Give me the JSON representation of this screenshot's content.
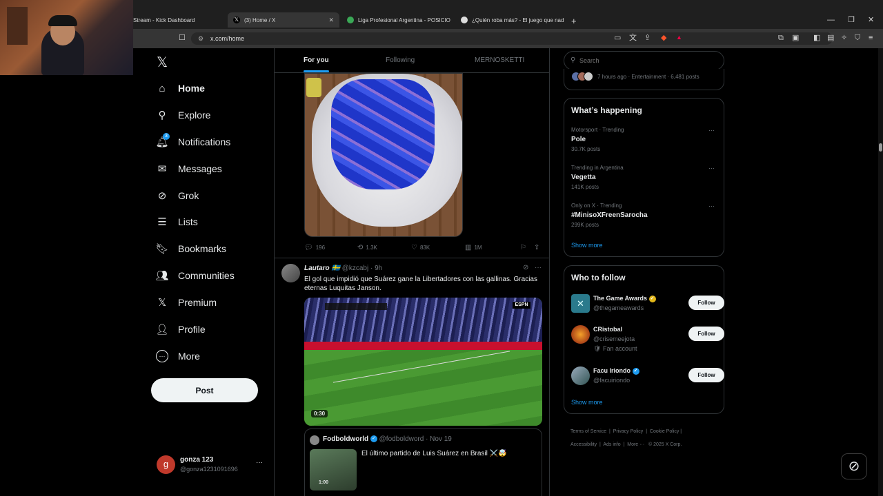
{
  "browser": {
    "tabs": [
      {
        "title": "Stream - Kick Dashboard"
      },
      {
        "title": "(3) Home / X"
      },
      {
        "title": "Liga Profesional Argentina - POSICIO"
      },
      {
        "title": "¿Quién roba más? - El juego que nad"
      }
    ],
    "address": "x.com/home",
    "new_tab": "+"
  },
  "colors": {
    "accent": "#1d9bf0",
    "bg": "#000000",
    "text": "#e7e9ea",
    "muted": "#71767b"
  },
  "nav": {
    "logo": "𝕏",
    "items": [
      {
        "label": "Home",
        "icon": "home-icon",
        "glyph": "⌂"
      },
      {
        "label": "Explore",
        "icon": "search-icon",
        "glyph": "⚲"
      },
      {
        "label": "Notifications",
        "icon": "bell-icon",
        "glyph": "🔔︎",
        "badge": "3"
      },
      {
        "label": "Messages",
        "icon": "mail-icon",
        "glyph": "✉"
      },
      {
        "label": "Grok",
        "icon": "grok-icon",
        "glyph": "⊘"
      },
      {
        "label": "Lists",
        "icon": "list-icon",
        "glyph": "☰"
      },
      {
        "label": "Bookmarks",
        "icon": "bookmark-icon",
        "glyph": "🔖︎"
      },
      {
        "label": "Communities",
        "icon": "people-icon",
        "glyph": "👥︎"
      },
      {
        "label": "Premium",
        "icon": "x-icon",
        "glyph": "𝕏"
      },
      {
        "label": "Profile",
        "icon": "person-icon",
        "glyph": "👤︎"
      },
      {
        "label": "More",
        "icon": "more-circle-icon",
        "glyph": "⋯"
      }
    ],
    "post_label": "Post",
    "account": {
      "name": "gonza 123",
      "handle": "@gonza1231091696",
      "avatar_letter": "g",
      "more": "···"
    }
  },
  "timeline": {
    "tabs": [
      "For you",
      "Following",
      "MERNOSKETTI"
    ],
    "post1": {
      "replies": "196",
      "reposts": "1.3K",
      "likes": "83K",
      "views": "1M"
    },
    "post2": {
      "author": "Lautaro 🇸🇪",
      "handle": "@kzcabj",
      "time": "· 9h",
      "text": "El gol que impidió que Suárez gane la Libertadores con las gallinas. Gracias eternas Luquitas Janson.",
      "video_duration": "0:30",
      "video_overlay": "ESPN",
      "quote": {
        "author": "Fodboldworld",
        "handle": "@fodboldword",
        "time": "· Nov 19",
        "text": "El último partido de Luis Suárez en Brasil ⚔️🤯",
        "duration": "1:00"
      }
    }
  },
  "right": {
    "search_placeholder": "Search",
    "trend_top": "7 hours ago · Entertainment · 6,481 posts",
    "whats_happening": {
      "title": "What’s happening",
      "items": [
        {
          "meta": "Motorsport · Trending",
          "name": "Pole",
          "posts": "30.7K posts"
        },
        {
          "meta": "Trending in Argentina",
          "name": "Vegetta",
          "posts": "141K posts"
        },
        {
          "meta": "Only on X · Trending",
          "name": "#MinisoXFreenSarocha",
          "posts": "299K posts"
        }
      ],
      "show_more": "Show more"
    },
    "who_to_follow": {
      "title": "Who to follow",
      "users": [
        {
          "name": "The Game Awards",
          "handle": "@thegameawards",
          "sub": ""
        },
        {
          "name": "CRistobal",
          "handle": "@crisemeejota",
          "sub": "Fan account"
        },
        {
          "name": "Facu Iriondo",
          "handle": "@facuiriondo",
          "sub": ""
        }
      ],
      "follow_label": "Follow",
      "show_more": "Show more"
    },
    "footer": {
      "line1": [
        "Terms of Service",
        "Privacy Policy",
        "Cookie Policy"
      ],
      "line2": [
        "Accessibility",
        "Ads info",
        "More ···",
        "© 2025 X Corp."
      ]
    }
  }
}
